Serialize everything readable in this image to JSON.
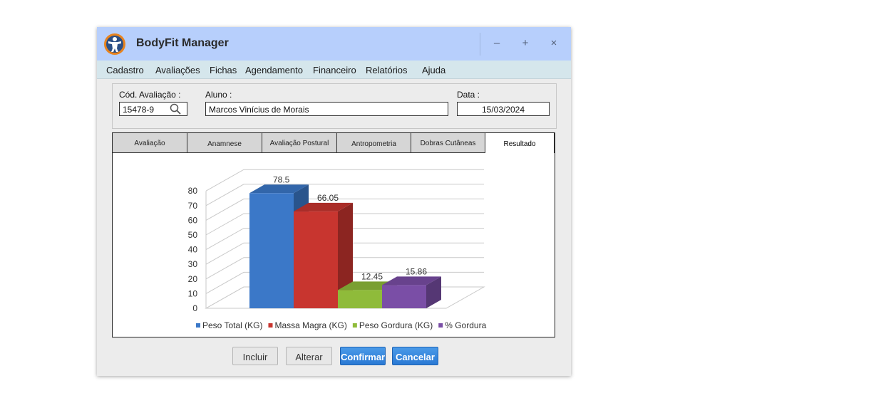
{
  "window": {
    "title": "BodyFit Manager",
    "min_glyph": "–",
    "max_glyph": "+",
    "close_glyph": "×"
  },
  "menu": [
    "Cadastro",
    "Avaliações",
    "Fichas",
    "Agendamento",
    "Financeiro",
    "Relatórios",
    "Ajuda"
  ],
  "form": {
    "cod_label": "Cód. Avaliação :",
    "cod_value": "15478-9",
    "aluno_label": "Aluno :",
    "aluno_value": "Marcos Vinícius de Morais",
    "data_label": "Data :",
    "data_value": "15/03/2024"
  },
  "tabs": [
    "Avaliação",
    "Anamnese",
    "Avaliação Postural",
    "Antropometria",
    "Dobras Cutâneas",
    "Resultado"
  ],
  "active_tab": "Resultado",
  "buttons": {
    "incluir": "Incluir",
    "alterar": "Alterar",
    "confirmar": "Confirmar",
    "cancelar": "Cancelar"
  },
  "chart_data": {
    "type": "bar",
    "categories": [
      "Peso Total (KG)",
      "Massa Magra (KG)",
      "Peso Gordura (KG)",
      "% Gordura"
    ],
    "values": [
      78.5,
      66.05,
      12.45,
      15.86
    ],
    "value_labels": [
      "78.5",
      "66.05",
      "12.45",
      "15.86"
    ],
    "colors": [
      "#3b78c8",
      "#c8352f",
      "#8fbb3a",
      "#7a4ea6"
    ],
    "ylim": [
      0,
      80
    ],
    "yticks": [
      0,
      10,
      20,
      30,
      40,
      50,
      60,
      70,
      80
    ],
    "grid": true,
    "legend": "bottom",
    "style": "3d"
  }
}
